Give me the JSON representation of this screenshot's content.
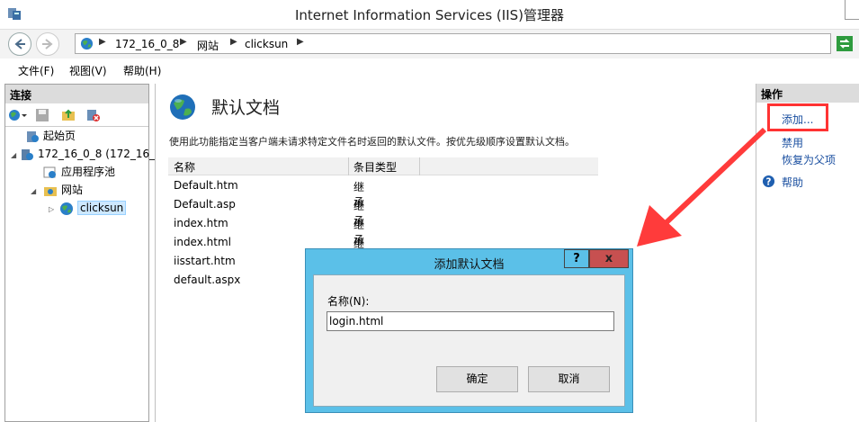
{
  "window": {
    "title": "Internet Information Services (IIS)管理器"
  },
  "address": {
    "crumbs": [
      "172_16_0_8",
      "网站",
      "clicksun"
    ]
  },
  "menu": {
    "items": [
      "文件(F)",
      "视图(V)",
      "帮助(H)"
    ]
  },
  "connections": {
    "header": "连接",
    "tree": [
      {
        "label": "起始页",
        "icon": "start-page-icon"
      },
      {
        "label": "172_16_0_8 (172_16_",
        "icon": "server-icon"
      },
      {
        "label": "应用程序池",
        "icon": "app-pool-icon"
      },
      {
        "label": "网站",
        "icon": "sites-folder-icon"
      },
      {
        "label": "clicksun",
        "icon": "globe-icon",
        "selected": true
      }
    ]
  },
  "content": {
    "title": "默认文档",
    "description": "使用此功能指定当客户端未请求特定文件名时返回的默认文件。按优先级顺序设置默认文档。",
    "columns": [
      "名称",
      "条目类型"
    ],
    "rows": [
      {
        "name": "Default.htm",
        "type": "继承"
      },
      {
        "name": "Default.asp",
        "type": "继承"
      },
      {
        "name": "index.htm",
        "type": "继承"
      },
      {
        "name": "index.html",
        "type": "继承"
      },
      {
        "name": "iisstart.htm",
        "type": ""
      },
      {
        "name": "default.aspx",
        "type": ""
      }
    ]
  },
  "actions": {
    "header": "操作",
    "add": "添加...",
    "disable": "禁用",
    "revert": "恢复为父项",
    "help": "帮助"
  },
  "dialog": {
    "title": "添加默认文档",
    "help_glyph": "?",
    "close_glyph": "x",
    "name_label": "名称(N):",
    "name_value": "login.html",
    "ok": "确定",
    "cancel": "取消"
  },
  "colors": {
    "dialog_frame": "#5bc0e8",
    "close_button": "#c75050",
    "highlight": "#ff3333",
    "link": "#1a4fa0"
  }
}
